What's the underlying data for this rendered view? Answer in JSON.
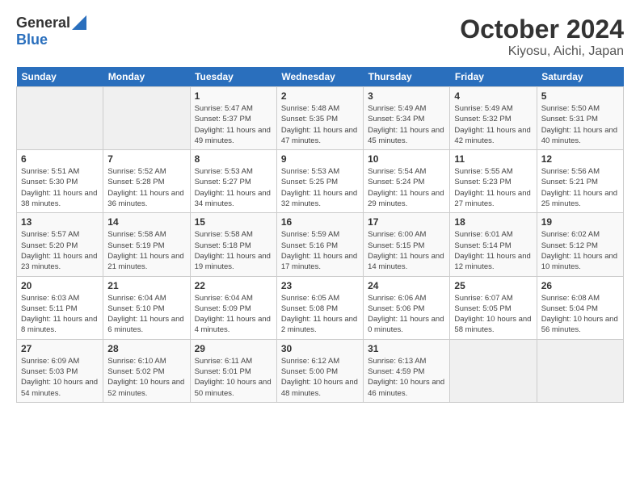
{
  "logo": {
    "general": "General",
    "blue": "Blue"
  },
  "title": "October 2024",
  "subtitle": "Kiyosu, Aichi, Japan",
  "days_header": [
    "Sunday",
    "Monday",
    "Tuesday",
    "Wednesday",
    "Thursday",
    "Friday",
    "Saturday"
  ],
  "weeks": [
    [
      {
        "day": "",
        "info": ""
      },
      {
        "day": "",
        "info": ""
      },
      {
        "day": "1",
        "info": "Sunrise: 5:47 AM\nSunset: 5:37 PM\nDaylight: 11 hours and 49 minutes."
      },
      {
        "day": "2",
        "info": "Sunrise: 5:48 AM\nSunset: 5:35 PM\nDaylight: 11 hours and 47 minutes."
      },
      {
        "day": "3",
        "info": "Sunrise: 5:49 AM\nSunset: 5:34 PM\nDaylight: 11 hours and 45 minutes."
      },
      {
        "day": "4",
        "info": "Sunrise: 5:49 AM\nSunset: 5:32 PM\nDaylight: 11 hours and 42 minutes."
      },
      {
        "day": "5",
        "info": "Sunrise: 5:50 AM\nSunset: 5:31 PM\nDaylight: 11 hours and 40 minutes."
      }
    ],
    [
      {
        "day": "6",
        "info": "Sunrise: 5:51 AM\nSunset: 5:30 PM\nDaylight: 11 hours and 38 minutes."
      },
      {
        "day": "7",
        "info": "Sunrise: 5:52 AM\nSunset: 5:28 PM\nDaylight: 11 hours and 36 minutes."
      },
      {
        "day": "8",
        "info": "Sunrise: 5:53 AM\nSunset: 5:27 PM\nDaylight: 11 hours and 34 minutes."
      },
      {
        "day": "9",
        "info": "Sunrise: 5:53 AM\nSunset: 5:25 PM\nDaylight: 11 hours and 32 minutes."
      },
      {
        "day": "10",
        "info": "Sunrise: 5:54 AM\nSunset: 5:24 PM\nDaylight: 11 hours and 29 minutes."
      },
      {
        "day": "11",
        "info": "Sunrise: 5:55 AM\nSunset: 5:23 PM\nDaylight: 11 hours and 27 minutes."
      },
      {
        "day": "12",
        "info": "Sunrise: 5:56 AM\nSunset: 5:21 PM\nDaylight: 11 hours and 25 minutes."
      }
    ],
    [
      {
        "day": "13",
        "info": "Sunrise: 5:57 AM\nSunset: 5:20 PM\nDaylight: 11 hours and 23 minutes."
      },
      {
        "day": "14",
        "info": "Sunrise: 5:58 AM\nSunset: 5:19 PM\nDaylight: 11 hours and 21 minutes."
      },
      {
        "day": "15",
        "info": "Sunrise: 5:58 AM\nSunset: 5:18 PM\nDaylight: 11 hours and 19 minutes."
      },
      {
        "day": "16",
        "info": "Sunrise: 5:59 AM\nSunset: 5:16 PM\nDaylight: 11 hours and 17 minutes."
      },
      {
        "day": "17",
        "info": "Sunrise: 6:00 AM\nSunset: 5:15 PM\nDaylight: 11 hours and 14 minutes."
      },
      {
        "day": "18",
        "info": "Sunrise: 6:01 AM\nSunset: 5:14 PM\nDaylight: 11 hours and 12 minutes."
      },
      {
        "day": "19",
        "info": "Sunrise: 6:02 AM\nSunset: 5:12 PM\nDaylight: 11 hours and 10 minutes."
      }
    ],
    [
      {
        "day": "20",
        "info": "Sunrise: 6:03 AM\nSunset: 5:11 PM\nDaylight: 11 hours and 8 minutes."
      },
      {
        "day": "21",
        "info": "Sunrise: 6:04 AM\nSunset: 5:10 PM\nDaylight: 11 hours and 6 minutes."
      },
      {
        "day": "22",
        "info": "Sunrise: 6:04 AM\nSunset: 5:09 PM\nDaylight: 11 hours and 4 minutes."
      },
      {
        "day": "23",
        "info": "Sunrise: 6:05 AM\nSunset: 5:08 PM\nDaylight: 11 hours and 2 minutes."
      },
      {
        "day": "24",
        "info": "Sunrise: 6:06 AM\nSunset: 5:06 PM\nDaylight: 11 hours and 0 minutes."
      },
      {
        "day": "25",
        "info": "Sunrise: 6:07 AM\nSunset: 5:05 PM\nDaylight: 10 hours and 58 minutes."
      },
      {
        "day": "26",
        "info": "Sunrise: 6:08 AM\nSunset: 5:04 PM\nDaylight: 10 hours and 56 minutes."
      }
    ],
    [
      {
        "day": "27",
        "info": "Sunrise: 6:09 AM\nSunset: 5:03 PM\nDaylight: 10 hours and 54 minutes."
      },
      {
        "day": "28",
        "info": "Sunrise: 6:10 AM\nSunset: 5:02 PM\nDaylight: 10 hours and 52 minutes."
      },
      {
        "day": "29",
        "info": "Sunrise: 6:11 AM\nSunset: 5:01 PM\nDaylight: 10 hours and 50 minutes."
      },
      {
        "day": "30",
        "info": "Sunrise: 6:12 AM\nSunset: 5:00 PM\nDaylight: 10 hours and 48 minutes."
      },
      {
        "day": "31",
        "info": "Sunrise: 6:13 AM\nSunset: 4:59 PM\nDaylight: 10 hours and 46 minutes."
      },
      {
        "day": "",
        "info": ""
      },
      {
        "day": "",
        "info": ""
      }
    ]
  ]
}
